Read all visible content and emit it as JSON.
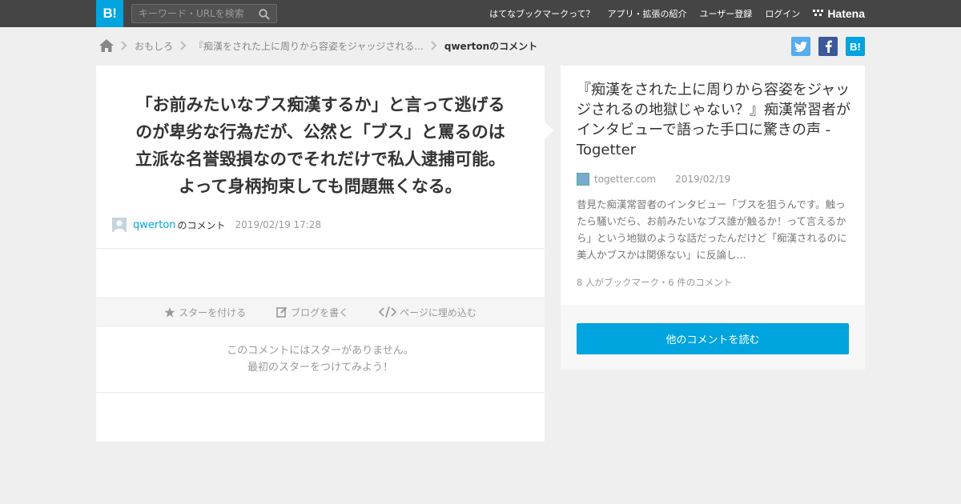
{
  "header": {
    "logo": "B!",
    "search_placeholder": "キーワード・URLを検索",
    "nav": [
      "はてなブックマークって？",
      "アプリ・拡張の紹介",
      "ユーザー登録",
      "ログイン"
    ],
    "brand": "Hatena"
  },
  "breadcrumb": {
    "items": [
      "おもしろ",
      "『痴漢をされた上に周りから容姿をジャッジされる..."
    ],
    "current": "qwertonのコメント"
  },
  "share": {
    "hatena_label": "B!"
  },
  "comment": {
    "lines": [
      "「お前みたいなブス痴漢するか」と言って逃げる",
      "のが卑劣な行為だが、公然と「ブス」と罵るのは",
      "立派な名誉毀損なのでそれだけで私人逮捕可能。",
      "よって身柄拘束しても問題無くなる。"
    ],
    "user": "qwerton",
    "user_suffix": "のコメント",
    "date": "2019/02/19 17:28"
  },
  "actions": {
    "star": "スターを付ける",
    "blog": "ブログを書く",
    "embed": "ページに埋め込む"
  },
  "stars": {
    "line1": "このコメントにはスターがありません。",
    "line2": "最初のスターをつけてみよう！"
  },
  "entry": {
    "title": "『痴漢をされた上に周りから容姿をジャッジされるの地獄じゃない？』痴漢常習者がインタビューで語った手口に驚きの声 - Togetter",
    "source": "togetter.com",
    "date": "2019/02/19",
    "summary": "昔見た痴漢常習者のインタビュー「ブスを狙うんです。触ったら騒いだら、お前みたいなブス誰が触るか！って言えるから」という地獄のような話だったんだけど「痴漢されるのに美人かブスかは関係ない」に反論し...",
    "stats": "8 人がブックマーク・6 件のコメント",
    "read_button": "他のコメントを読む"
  },
  "colors": {
    "accent": "#00a4de",
    "topbar": "#454545",
    "twitter": "#55acee",
    "facebook": "#3b5998"
  }
}
